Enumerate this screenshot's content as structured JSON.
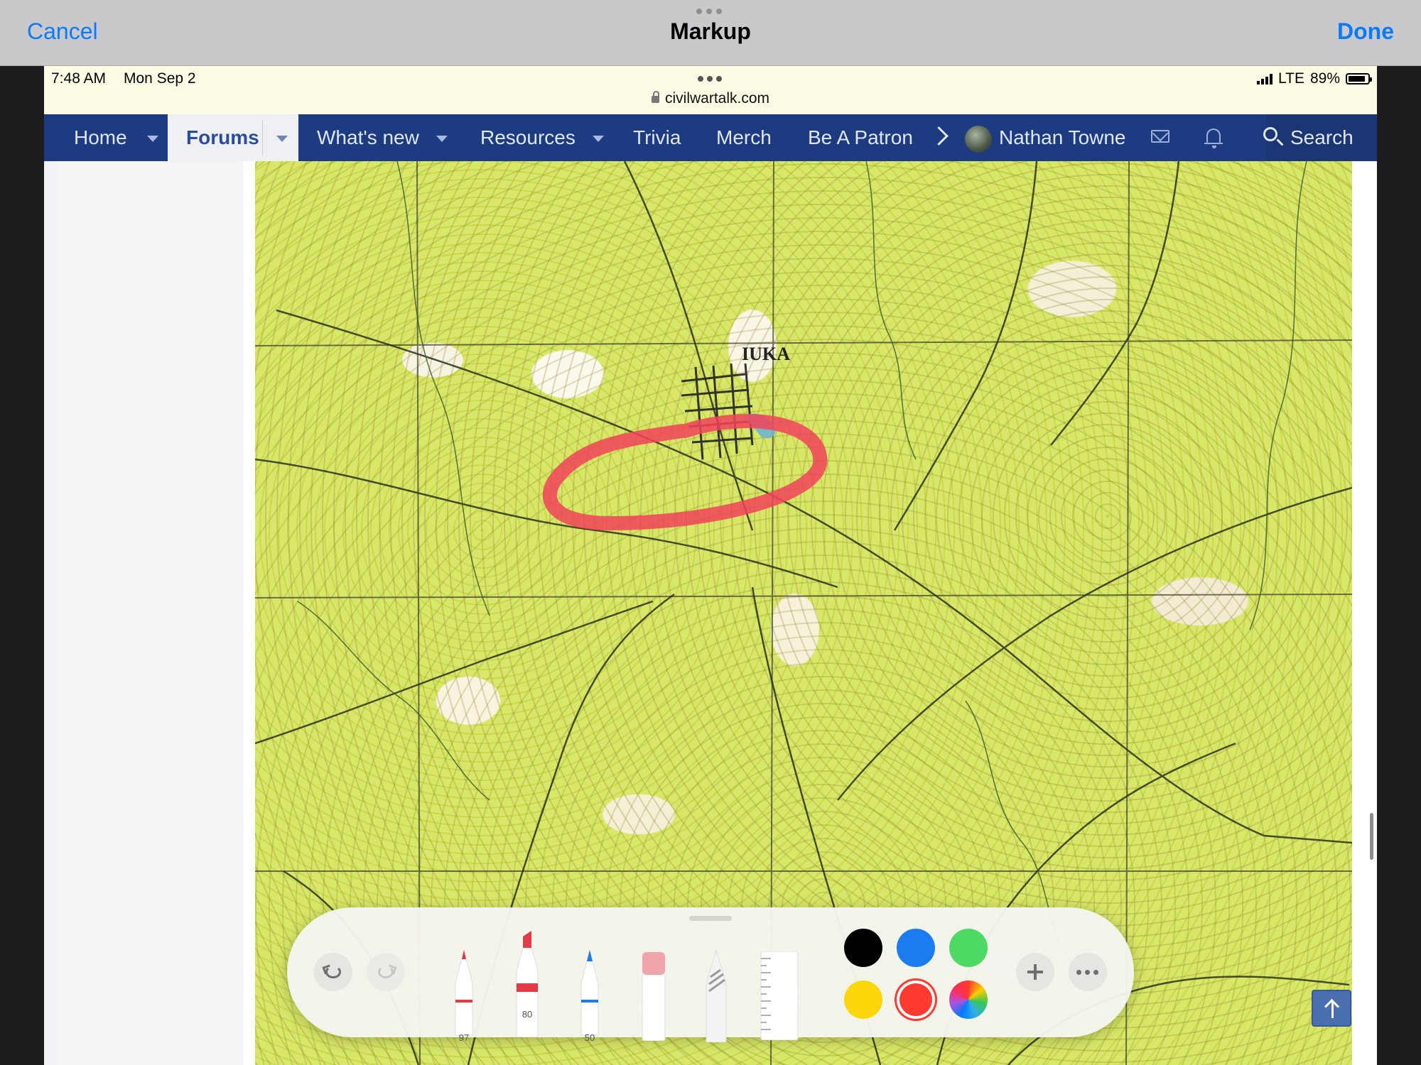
{
  "markup": {
    "cancel_label": "Cancel",
    "title": "Markup",
    "done_label": "Done"
  },
  "status_bar": {
    "time": "7:48 AM",
    "date": "Mon Sep 2",
    "url": "civilwartalk.com",
    "network": "LTE",
    "battery": "89%",
    "battery_level": 0.89
  },
  "nav": {
    "items": [
      {
        "label": "Home",
        "has_dropdown": true
      },
      {
        "label": "Forums",
        "has_dropdown": true,
        "active": true
      },
      {
        "label": "What's new",
        "has_dropdown": true
      },
      {
        "label": "Resources",
        "has_dropdown": true
      },
      {
        "label": "Trivia"
      },
      {
        "label": "Merch"
      },
      {
        "label": "Be A Patron"
      }
    ],
    "user_name": "Nathan Towne",
    "search_label": "Search"
  },
  "map": {
    "place_label": "IUKA",
    "annotation_color": "#f0445a"
  },
  "palette": {
    "tools": [
      {
        "name": "pen",
        "value": "97",
        "color": "#e63946"
      },
      {
        "name": "marker",
        "value": "80",
        "color": "#e63946"
      },
      {
        "name": "pencil",
        "value": "50",
        "color": "#1e7be0"
      },
      {
        "name": "eraser"
      },
      {
        "name": "lasso"
      },
      {
        "name": "ruler"
      }
    ],
    "colors": [
      "#000000",
      "#1a7cf0",
      "#4cd964",
      "#ffd60a",
      "#ff3b30",
      "color-wheel"
    ],
    "selected_color": "#ff3b30"
  }
}
